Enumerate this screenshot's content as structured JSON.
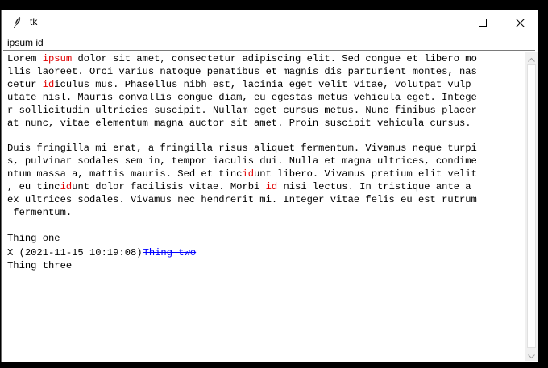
{
  "window": {
    "title": "tk",
    "icon": "feather-icon"
  },
  "controls": {
    "minimize_icon": "minimize-icon",
    "maximize_icon": "maximize-icon",
    "close_icon": "close-icon"
  },
  "entry": {
    "value": "ipsum id"
  },
  "text": {
    "paragraph1": [
      [
        {
          "t": "Lorem "
        },
        {
          "t": "ipsum",
          "hl": true
        },
        {
          "t": " dolor sit amet, consectetur adipiscing elit. Sed congue et libero mo"
        }
      ],
      [
        {
          "t": "llis laoreet. Orci varius natoque penatibus et magnis dis parturient montes, nas"
        }
      ],
      [
        {
          "t": "cetur "
        },
        {
          "t": "id",
          "hl": true
        },
        {
          "t": "iculus mus. Phasellus nibh est, lacinia eget velit vitae, volutpat vulp"
        }
      ],
      [
        {
          "t": "utate nisl. Mauris convallis congue diam, eu egestas metus vehicula eget. Intege"
        }
      ],
      [
        {
          "t": "r sollicitudin ultricies suscipit. Nullam eget cursus metus. Nunc finibus placer"
        }
      ],
      [
        {
          "t": "at nunc, vitae elementum magna auctor sit amet. Proin suscipit vehicula cursus."
        }
      ]
    ],
    "paragraph2": [
      [
        {
          "t": "Duis fringilla mi erat, a fringilla risus aliquet fermentum. Vivamus neque turpi"
        }
      ],
      [
        {
          "t": "s, pulvinar sodales sem in, tempor iaculis dui. Nulla et magna ultrices, condime"
        }
      ],
      [
        {
          "t": "ntum massa a, mattis mauris. Sed et tinc"
        },
        {
          "t": "id",
          "hl": true
        },
        {
          "t": "unt libero. Vivamus pretium elit velit"
        }
      ],
      [
        {
          "t": ", eu tinc"
        },
        {
          "t": "id",
          "hl": true
        },
        {
          "t": "unt dolor facilisis vitae. Morbi "
        },
        {
          "t": "id",
          "hl": true
        },
        {
          "t": " nisi lectus. In tristique ante a"
        }
      ],
      [
        {
          "t": "ex ultrices sodales. Vivamus nec hendrerit mi. Integer vitae felis eu est rutrum"
        }
      ],
      [
        {
          "t": " fermentum."
        }
      ]
    ],
    "list": {
      "line1": "Thing one",
      "line2_prefix": "X (2021-11-15 10:19:08)",
      "line2_struck": "Thing two",
      "line3": "Thing three"
    }
  },
  "colors": {
    "highlight": "#e00000",
    "strike": "#0000ff"
  }
}
